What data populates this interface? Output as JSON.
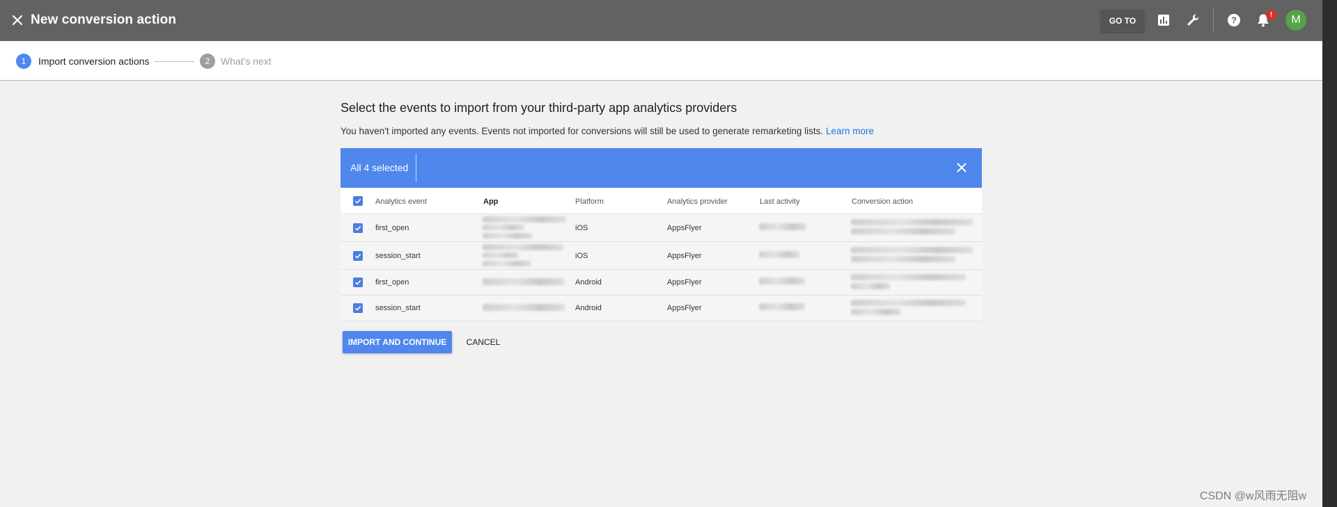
{
  "header": {
    "title": "New conversion action",
    "goto_label": "GO TO",
    "notification_badge": "!",
    "avatar_initial": "M",
    "icons": [
      "close-icon",
      "reports-icon",
      "wrench-icon",
      "help-icon",
      "bell-icon"
    ]
  },
  "stepper": {
    "steps": [
      {
        "number": "1",
        "label": "Import conversion actions",
        "state": "active"
      },
      {
        "number": "2",
        "label": "What's next",
        "state": "inactive"
      }
    ]
  },
  "main": {
    "heading": "Select the events to import from your third-party app analytics providers",
    "subtext": "You haven't imported any events. Events not imported for conversions will still be used to generate remarketing lists.",
    "learn_more": "Learn more"
  },
  "selection_bar": {
    "label": "All 4 selected"
  },
  "table": {
    "columns": [
      "Analytics event",
      "App",
      "Platform",
      "Analytics provider",
      "Last activity",
      "Conversion action"
    ],
    "rows": [
      {
        "checked": true,
        "event": "first_open",
        "platform": "iOS",
        "provider": "AppsFlyer"
      },
      {
        "checked": true,
        "event": "session_start",
        "platform": "iOS",
        "provider": "AppsFlyer"
      },
      {
        "checked": true,
        "event": "first_open",
        "platform": "Android",
        "provider": "AppsFlyer"
      },
      {
        "checked": true,
        "event": "session_start",
        "platform": "Android",
        "provider": "AppsFlyer"
      }
    ]
  },
  "actions": {
    "import_label": "IMPORT AND CONTINUE",
    "cancel_label": "CANCEL"
  },
  "watermark": "CSDN @w风雨无阻w",
  "colors": {
    "topbar": "#626262",
    "primary_blue": "#4f87ec",
    "link_blue": "#1a73e8",
    "avatar_green": "#57a146",
    "badge_red": "#d93025"
  }
}
